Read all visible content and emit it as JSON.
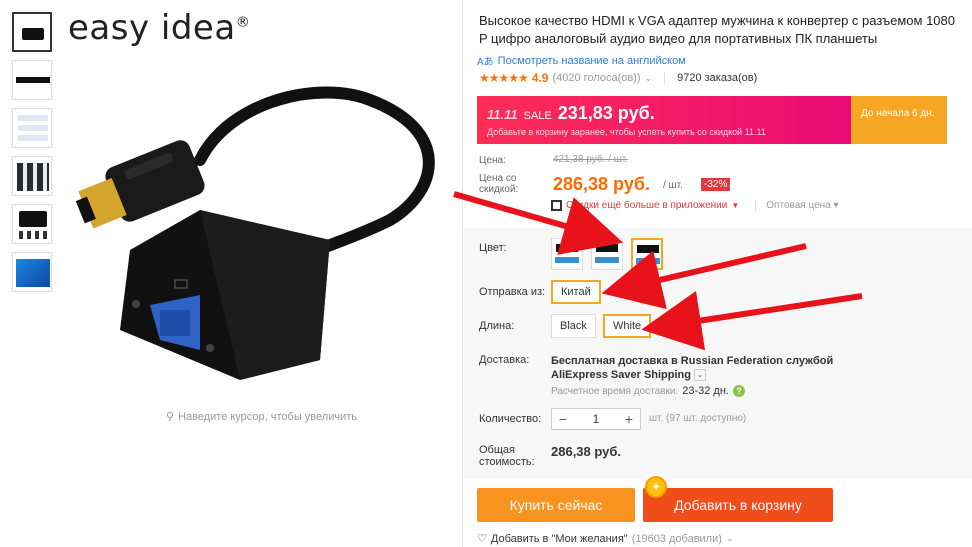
{
  "brand": {
    "name": "easy idea",
    "mark": "®"
  },
  "gallery": {
    "zoom_hint": "Наведите курсор, чтобы увеличить"
  },
  "product": {
    "title": "Высокое качество HDMI к VGA адаптер мужчина к конвертер с разъемом 1080 P цифро аналоговый аудио видео для портативных ПК планшеты",
    "translate_link": "Посмотреть название на английском",
    "stars": "★★★★★",
    "rating": "4.9",
    "votes": "(4020 голоса(ов))",
    "orders": "9720 заказа(ов)"
  },
  "banner": {
    "mark": "11.11",
    "sale_label": "SALE",
    "price": "231,83 руб.",
    "subtitle": "Добавьте в корзину заранее, чтобы успеть купить со скидкой 11.11",
    "countdown": "До начала 6 дн.",
    "colors": {
      "from": "#ff2d55",
      "to": "#e6007e",
      "timer": "#f5a623"
    }
  },
  "price": {
    "label": "Цена:",
    "old": "421,38 руб. / шт.",
    "discount_label": "Цена со скидкой:",
    "new": "286,38 руб.",
    "unit": "/ шт.",
    "discount": "-32%",
    "app_deal": "Скидки ещё больше в приложении",
    "wholesale": "Оптовая цена"
  },
  "sku": {
    "color_label": "Цвет:",
    "ship_from_label": "Отправка из:",
    "ship_from_value": "Китай",
    "length_label": "Длина:",
    "length_options": [
      "Black",
      "White"
    ],
    "delivery_label": "Доставка:",
    "delivery_text": "Бесплатная доставка в Russian Federation службой AliExpress Saver Shipping",
    "delivery_time_label": "Расчетное время доставки:",
    "delivery_time": "23-32 дн.",
    "qty_label": "Количество:",
    "qty": "1",
    "minus": "−",
    "plus": "+",
    "available": "шт. (97 шт. доступно)",
    "total_label": "Общая стоимость:",
    "total": "286,38 руб."
  },
  "actions": {
    "buy_now": "Купить сейчас",
    "add_to_cart": "Добавить в корзину",
    "wishlist": "Добавить в \"Мои желания\"",
    "wishlist_count": "(19603 добавили)"
  },
  "accent_colors": {
    "orange": "#ff6a00",
    "red_arrow": "#e8121b",
    "selected_border": "#f5a623"
  }
}
